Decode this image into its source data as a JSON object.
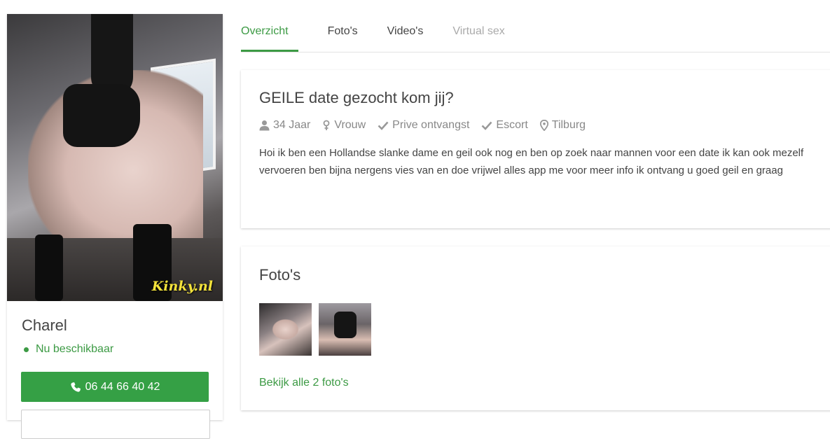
{
  "profile": {
    "watermark": "Kinky.nl",
    "name": "Charel",
    "availability": "Nu beschikbaar",
    "phone": "06 44 66 40 42",
    "status_color": "#3c9a44"
  },
  "tabs": [
    {
      "label": "Overzicht",
      "active": true
    },
    {
      "label": "Foto's",
      "active": false
    },
    {
      "label": "Video's",
      "active": false
    },
    {
      "label": "Virtual sex",
      "active": false,
      "disabled": true
    }
  ],
  "info": {
    "title": "GEILE date gezocht kom jij?",
    "meta": [
      {
        "icon": "user-icon",
        "text": "34 Jaar"
      },
      {
        "icon": "gender-female-icon",
        "text": "Vrouw"
      },
      {
        "icon": "check-icon",
        "text": "Prive ontvangst"
      },
      {
        "icon": "check-icon",
        "text": "Escort"
      },
      {
        "icon": "map-marker-icon",
        "text": "Tilburg"
      }
    ],
    "description": "Hoi ik ben een Hollandse slanke dame en geil ook nog en ben op zoek naar mannen voor een date ik kan ook mezelf vervoeren ben bijna nergens vies van en doe vrijwel alles app me voor meer info ik ontvang u goed geil en graag"
  },
  "photos": {
    "title": "Foto's",
    "see_all": "Bekijk alle 2 foto's"
  },
  "colors": {
    "accent": "#3c9a44",
    "button": "#35a045",
    "muted": "#aaaaaa"
  }
}
